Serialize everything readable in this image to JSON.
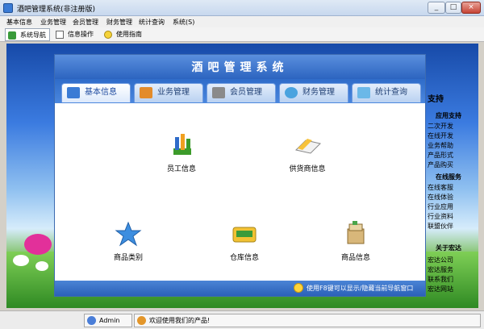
{
  "window": {
    "title": "酒吧管理系统(非注册版)",
    "minimize": "_",
    "maximize": "□",
    "close": "×"
  },
  "menu": [
    "基本信息",
    "业务管理",
    "会员管理",
    "财务管理",
    "统计查询",
    "系统(S)"
  ],
  "toolbar": [
    {
      "label": "系统导航",
      "icon": "navigation-icon"
    },
    {
      "label": "信息操作",
      "icon": "info-operation-icon"
    },
    {
      "label": "使用指南",
      "icon": "help-icon"
    }
  ],
  "side_panel": {
    "header": "支持",
    "sections": [
      {
        "title": "应用支持",
        "items": [
          "二次开发",
          "在线开发",
          "业务帮助",
          "产品形式",
          "产品购买"
        ]
      },
      {
        "title": "在线服务",
        "items": [
          "在线客服",
          "在线体验",
          "行业应用",
          "行业资料",
          "联盟伙伴"
        ]
      },
      {
        "title": "关于宏达",
        "items": [
          "宏达公司",
          "宏达服务",
          "联系我们",
          "宏达网站"
        ]
      }
    ]
  },
  "dialog": {
    "title": "酒吧管理系统",
    "tabs": [
      {
        "label": "基本信息",
        "icon": "monitor-icon",
        "active": true
      },
      {
        "label": "业务管理",
        "icon": "business-icon",
        "active": false
      },
      {
        "label": "会员管理",
        "icon": "member-icon",
        "active": false
      },
      {
        "label": "财务管理",
        "icon": "finance-icon",
        "active": false
      },
      {
        "label": "统计查询",
        "icon": "stats-icon",
        "active": false
      }
    ],
    "modules": [
      {
        "label": "员工信息",
        "icon": "employee-icon"
      },
      {
        "label": "供货商信息",
        "icon": "supplier-icon"
      },
      {
        "label": "商品类别",
        "icon": "category-star-icon"
      },
      {
        "label": "仓库信息",
        "icon": "warehouse-icon"
      },
      {
        "label": "商品信息",
        "icon": "product-icon"
      }
    ],
    "tip": "使用F8键可以显示/隐藏当前导航窗口"
  },
  "status": {
    "user": "Admin",
    "message": "欢迎使用我们的产品!"
  },
  "colors": {
    "accent": "#2c64c0",
    "tab_active": "#1d4aa0"
  }
}
